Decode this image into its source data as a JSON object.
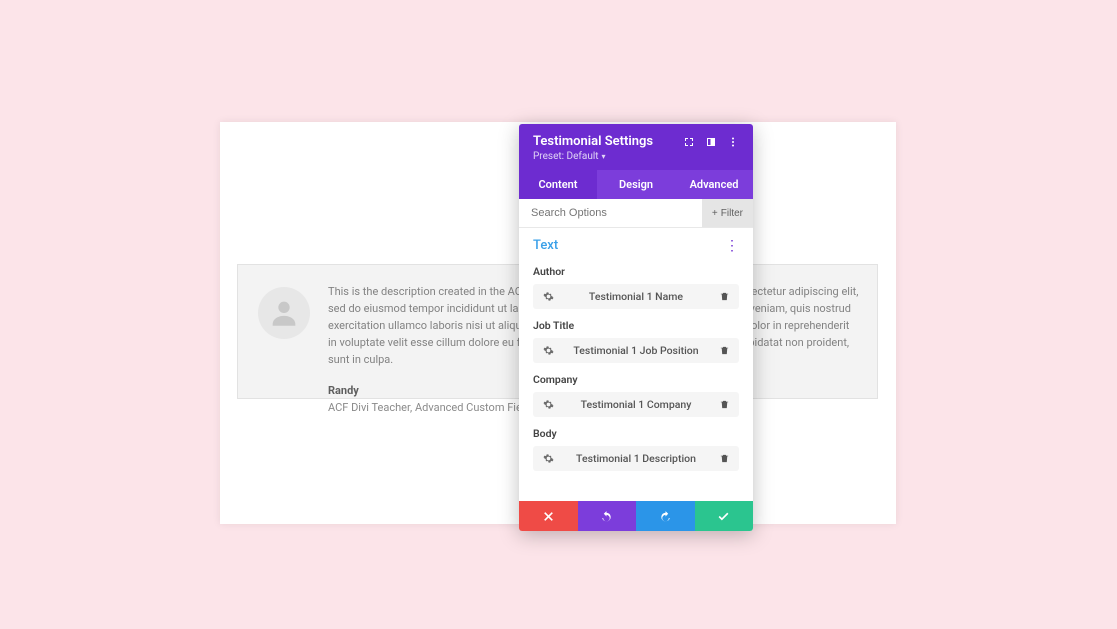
{
  "testimonial": {
    "body": "This is the description created in the ACF field group. Lorem ipsum dolor sit amet, consectetur adipiscing elit, sed do eiusmod tempor incididunt ut labore et dolore magna aliqua. Ut enim ad minim veniam, quis nostrud exercitation ullamco laboris nisi ut aliquip ex ea commodo consequat. Duis aute irure dolor in reprehenderit in voluptate velit esse cillum dolore eu fugiat nulla pariatur. Excepteur sint occaecat cupidatat non proident, sunt in culpa.",
    "name": "Randy",
    "meta": "ACF Divi Teacher, Advanced Custom Fields"
  },
  "modal": {
    "title": "Testimonial Settings",
    "preset_label": "Preset: Default",
    "tabs": {
      "content": "Content",
      "design": "Design",
      "advanced": "Advanced"
    },
    "search_placeholder": "Search Options",
    "filter_label": "Filter",
    "section_title": "Text",
    "fields": {
      "author": {
        "label": "Author",
        "value": "Testimonial 1 Name"
      },
      "job_title": {
        "label": "Job Title",
        "value": "Testimonial 1 Job Position"
      },
      "company": {
        "label": "Company",
        "value": "Testimonial 1 Company"
      },
      "body": {
        "label": "Body",
        "value": "Testimonial 1 Description"
      }
    }
  }
}
